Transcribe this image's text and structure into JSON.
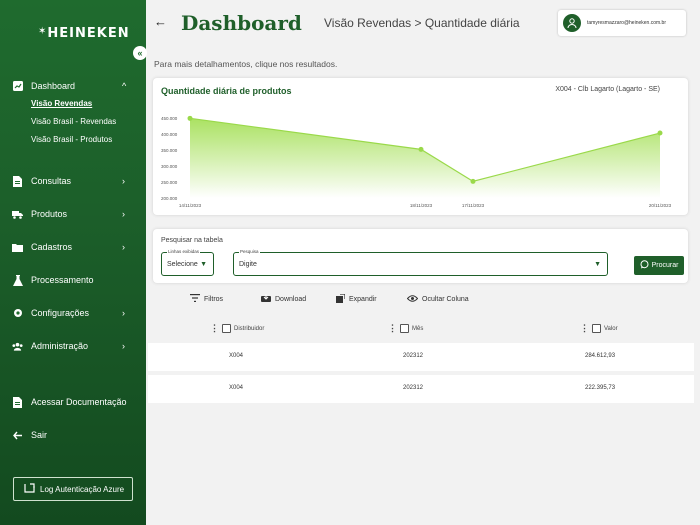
{
  "brand": {
    "logo_text": "HEINEKEN",
    "star": "✶",
    "collapse_glyph": "«"
  },
  "sidebar": {
    "items": [
      {
        "key": "dashboard",
        "label": "Dashboard",
        "icon": "chart-icon",
        "chevron": "^"
      },
      {
        "key": "consultas",
        "label": "Consultas",
        "icon": "document-icon",
        "chevron": "›"
      },
      {
        "key": "produtos",
        "label": "Produtos",
        "icon": "truck-icon",
        "chevron": "›"
      },
      {
        "key": "cadastros",
        "label": "Cadastros",
        "icon": "folder-icon",
        "chevron": "›"
      },
      {
        "key": "processamento",
        "label": "Processamento",
        "icon": "flask-icon"
      },
      {
        "key": "configuracoes",
        "label": "Configurações",
        "icon": "gear-icon",
        "chevron": "›"
      },
      {
        "key": "administracao",
        "label": "Administração",
        "icon": "users-icon",
        "chevron": "›"
      },
      {
        "key": "documentacao",
        "label": "Acessar Documentação",
        "icon": "document-icon"
      },
      {
        "key": "sair",
        "label": "Sair",
        "icon": "logout-icon"
      }
    ],
    "subitems": [
      "Visão Revendas",
      "Visão Brasil - Revendas",
      "Visão Brasil - Produtos"
    ],
    "azure_label": "Log Autenticação Azure"
  },
  "header": {
    "back_glyph": "←",
    "title": "Dashboard",
    "breadcrumb": "Visão Revendas > Quantidade diária",
    "user_email": "tamyresmazzaro@heineken.com.br"
  },
  "hint": "Para mais detalhamentos, clique nos resultados.",
  "chart_data": {
    "type": "area",
    "title": "Quantidade diária de produtos",
    "subtitle": "X004 - Clb Lagarto (Lagarto - SE)",
    "x": [
      "14/11/2023",
      "18/11/2023",
      "17/11/2023",
      "20/11/2023"
    ],
    "values": [
      449000,
      352000,
      252000,
      403000
    ],
    "yticks": [
      "450.000",
      "400.000",
      "350.000",
      "300.000",
      "250.000",
      "200.000"
    ],
    "ylim": [
      200000,
      450000
    ],
    "colors": {
      "line": "#9ad94a",
      "fill_top": "#a6e05a",
      "fill_bottom": "#ffffff"
    }
  },
  "search": {
    "label": "Pesquisar na tabela",
    "lines_label": "Linhas exibidas",
    "lines_value": "Selecione",
    "query_label": "Pesquisa",
    "query_value": "Digite",
    "button": "Procurar",
    "caret": "▼"
  },
  "toolbar": {
    "filters": "Filtros",
    "download": "Download",
    "expand": "Expandir",
    "hide_column": "Ocultar Coluna"
  },
  "table": {
    "columns": [
      "Distribuidor",
      "Mês",
      "Valor"
    ],
    "rows": [
      [
        "X004",
        "202312",
        "284.612,93"
      ],
      [
        "X004",
        "202312",
        "222.395,73"
      ]
    ]
  },
  "colors": {
    "brand_green": "#1f5f2a",
    "accent_lime": "#9ad94a"
  }
}
